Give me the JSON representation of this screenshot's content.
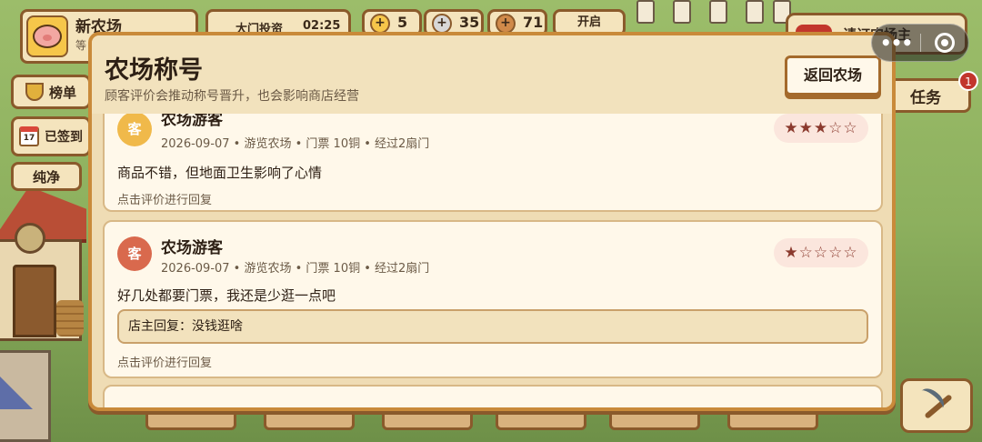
{
  "hud": {
    "farm_name": "新农场",
    "farm_sub": "等",
    "gate_label": "大门投资",
    "gate_time": "02:25",
    "coins": [
      {
        "symbol": "+",
        "value": "5"
      },
      {
        "symbol": "+",
        "value": "35"
      },
      {
        "symbol": "+",
        "value": "71"
      }
    ],
    "open_label": "开启",
    "rank_label": "榜单",
    "signin_label": "已签到",
    "signin_day": "17",
    "pure_label": "纯净",
    "recruit_label": "请订农场主",
    "task_label": "任务",
    "task_badge": "1"
  },
  "capsule": {
    "more": "•••"
  },
  "modal": {
    "title": "农场称号",
    "subtitle": "顾客评价会推动称号晋升，也会影响商店经营",
    "back_label": "返回农场"
  },
  "reviews": [
    {
      "avatar": "客",
      "avatar_color": "#f0b94a",
      "name": "农场游客",
      "meta": "2026-09-07 • 游览农场 • 门票 10铜 • 经过2扇门",
      "text": "商品不错，但地面卫生影响了心情",
      "stars": "★★★☆☆",
      "rating": 3,
      "reply": "",
      "hint": "点击评价进行回复"
    },
    {
      "avatar": "客",
      "avatar_color": "#d9694d",
      "name": "农场游客",
      "meta": "2026-09-07 • 游览农场 • 门票 10铜 • 经过2扇门",
      "text": "好几处都要门票，我还是少逛一点吧",
      "stars": "★☆☆☆☆",
      "rating": 1,
      "reply": "店主回复：没钱逛啥",
      "hint": "点击评价进行回复"
    }
  ]
}
